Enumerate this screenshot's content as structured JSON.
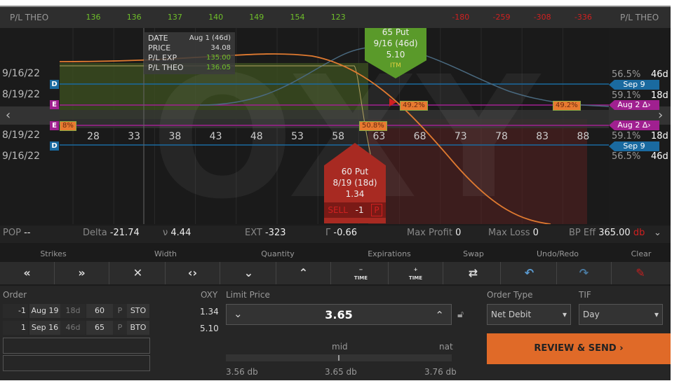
{
  "header": {
    "left_label": "P/L THEO",
    "right_label": "P/L THEO",
    "values": [
      {
        "v": "136",
        "c": "g",
        "k": 28
      },
      {
        "v": "136",
        "c": "g",
        "k": 33
      },
      {
        "v": "137",
        "c": "g",
        "k": 38
      },
      {
        "v": "140",
        "c": "g",
        "k": 43
      },
      {
        "v": "149",
        "c": "g",
        "k": 48
      },
      {
        "v": "154",
        "c": "g",
        "k": 53
      },
      {
        "v": "123",
        "c": "g",
        "k": 58
      },
      {
        "v": "-180",
        "c": "r",
        "k": 73
      },
      {
        "v": "-259",
        "c": "r",
        "k": 78
      },
      {
        "v": "-308",
        "c": "r",
        "k": 83
      },
      {
        "v": "-336",
        "c": "r",
        "k": 88
      }
    ]
  },
  "strikes": [
    "28",
    "33",
    "38",
    "43",
    "48",
    "53",
    "58",
    "63",
    "68",
    "73",
    "78",
    "83",
    "88"
  ],
  "tooltip": {
    "date_label": "DATE",
    "date": "Aug 1 (46d)",
    "price_label": "PRICE",
    "price": "34.08",
    "plexp_label": "P/L EXP",
    "plexp": "135.00",
    "pltheo_label": "P/L THEO",
    "pltheo": "136.05"
  },
  "long_leg": {
    "title": "65 Put",
    "exp": "9/16 (46d)",
    "price": "5.10",
    "status": "ITM"
  },
  "short_leg": {
    "title": "60 Put",
    "exp": "8/19 (18d)",
    "price": "1.34",
    "action": "SELL",
    "qty": "-1",
    "type": "P"
  },
  "left_dates": [
    "9/16/22",
    "8/19/22",
    "8/19/22",
    "9/16/22"
  ],
  "markers": {
    "d": "D",
    "e": "E"
  },
  "pcts": {
    "a": "49.2%",
    "b": "49.2%",
    "c": "50.8%",
    "d": "8%"
  },
  "right_panel": {
    "top": [
      {
        "iv": "56.5%",
        "dte": "46d"
      },
      {
        "iv": "59.1%",
        "dte": "18d"
      }
    ],
    "bottom": [
      {
        "iv": "59.1%",
        "dte": "18d"
      },
      {
        "iv": "56.5%",
        "dte": "46d"
      }
    ],
    "sep": "Sep 9",
    "aug": "Aug 2 ∆›"
  },
  "stats": {
    "pop_label": "POP",
    "pop": "--",
    "delta_label": "Delta",
    "delta": "-21.74",
    "vega_label": "ν",
    "vega": "4.44",
    "ext_label": "EXT",
    "ext": "-323",
    "gamma_label": "Γ",
    "gamma": "-0.66",
    "maxp_label": "Max Profit",
    "maxp": "0",
    "maxl_label": "Max Loss",
    "maxl": "0",
    "bp_label": "BP Eff",
    "bp": "365.00",
    "bp_unit": "db"
  },
  "toolbar": {
    "labels": [
      "Strikes",
      "Width",
      "Quantity",
      "Expirations",
      "Swap",
      "Undo/Redo",
      "Clear"
    ],
    "time": "TIME"
  },
  "order": {
    "label": "Order",
    "sym": "OXY",
    "rows": [
      {
        "qty": "-1",
        "exp": "Aug 19",
        "dte": "18d",
        "strike": "60",
        "type": "P",
        "action": "STO",
        "price": "1.34"
      },
      {
        "qty": "1",
        "exp": "Sep 16",
        "dte": "46d",
        "strike": "65",
        "type": "P",
        "action": "BTO",
        "price": "5.10"
      }
    ],
    "limit_label": "Limit Price",
    "limit": "3.65",
    "mid": "mid",
    "nat": "nat",
    "low": "3.56 db",
    "midv": "3.65 db",
    "high": "3.76 db",
    "order_type_label": "Order Type",
    "order_type": "Net Debit",
    "tif_label": "TIF",
    "tif": "Day",
    "submit": "REVIEW & SEND"
  }
}
